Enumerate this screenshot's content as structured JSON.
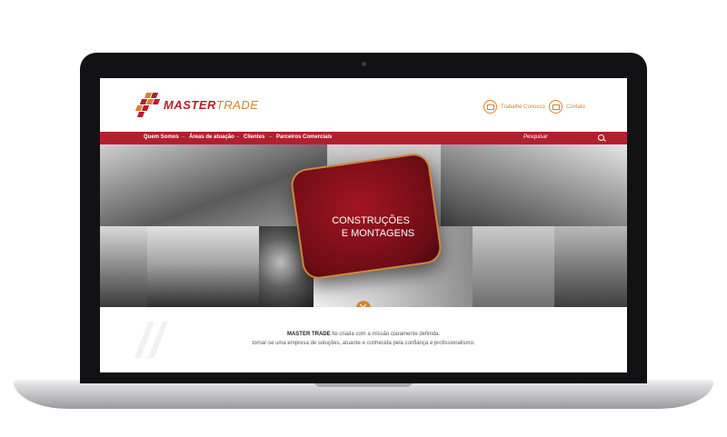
{
  "brand": {
    "name_part1": "MASTER",
    "name_part2": "TRADE",
    "colors": {
      "primary": "#b41f2d",
      "accent": "#d6822b",
      "dark": "#121214"
    }
  },
  "header": {
    "links": [
      {
        "label": "Trabalhe Conosco",
        "icon": "mail-icon"
      },
      {
        "label": "Contato",
        "icon": "mail-icon"
      }
    ]
  },
  "nav": {
    "items": [
      {
        "label": "Quem Somos"
      },
      {
        "label": "Áreas de atuação"
      },
      {
        "label": "Clientes"
      },
      {
        "label": "Parceiros Comerciais"
      }
    ],
    "separator": "–",
    "search_placeholder": "Pesquisar"
  },
  "hero": {
    "title_line1": "CONSTRUÇÕES",
    "title_line2": "E MONTAGENS"
  },
  "intro": {
    "brand_bold": "MASTER TRADE",
    "line1_rest": " foi criada com a missão claramente definida:",
    "line2": "tornar-se uma empresa de soluções, atuante e conhecida pela confiança e profissionalismo."
  }
}
